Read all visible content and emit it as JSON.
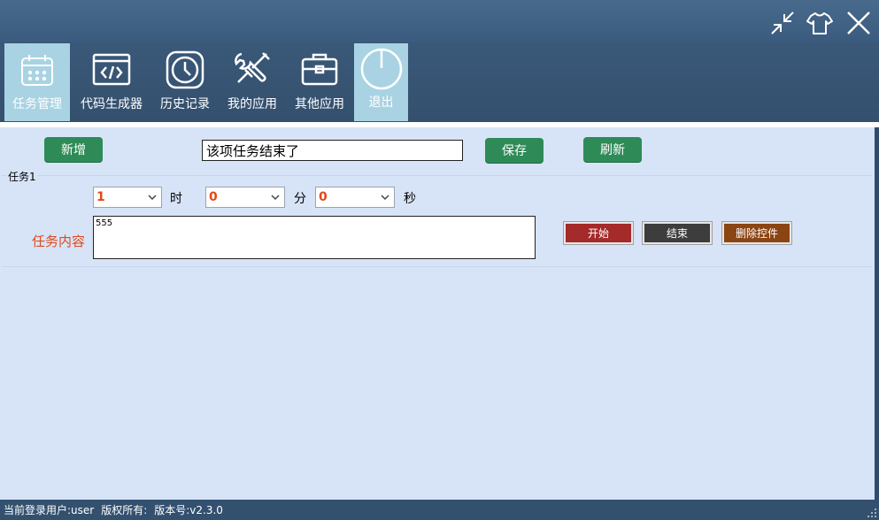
{
  "window": {
    "controls": [
      {
        "name": "restore-icon"
      },
      {
        "name": "skin-icon"
      },
      {
        "name": "close-icon"
      }
    ]
  },
  "toolbar": {
    "items": [
      {
        "label": "任务管理",
        "icon": "calendar-icon",
        "active": true
      },
      {
        "label": "代码生成器",
        "icon": "code-icon",
        "active": false
      },
      {
        "label": "历史记录",
        "icon": "clock-icon",
        "active": false
      },
      {
        "label": "我的应用",
        "icon": "tools-icon",
        "active": false
      },
      {
        "label": "其他应用",
        "icon": "toolbox-icon",
        "active": false
      },
      {
        "label": "退出",
        "icon": "power-icon",
        "active": true
      }
    ]
  },
  "actions": {
    "add_label": "新增",
    "title_value": "该项任务结束了",
    "save_label": "保存",
    "refresh_label": "刷新"
  },
  "task": {
    "group_label": "任务1",
    "hour_value": "1",
    "hour_unit": "时",
    "minute_value": "0",
    "minute_unit": "分",
    "second_value": "0",
    "second_unit": "秒",
    "content_label": "任务内容",
    "content_value": "555",
    "start_label": "开始",
    "end_label": "结束",
    "delete_label": "删除控件"
  },
  "status": {
    "user": "当前登录用户:user",
    "copyright": "版权所有:",
    "version": "版本号:v2.3.0"
  },
  "colors": {
    "accent_green": "#2e8b57",
    "start_red": "#a52a2a",
    "end_dark": "#3d3d3d",
    "delete_brown": "#8b4513",
    "label_orange": "#e0491b"
  }
}
